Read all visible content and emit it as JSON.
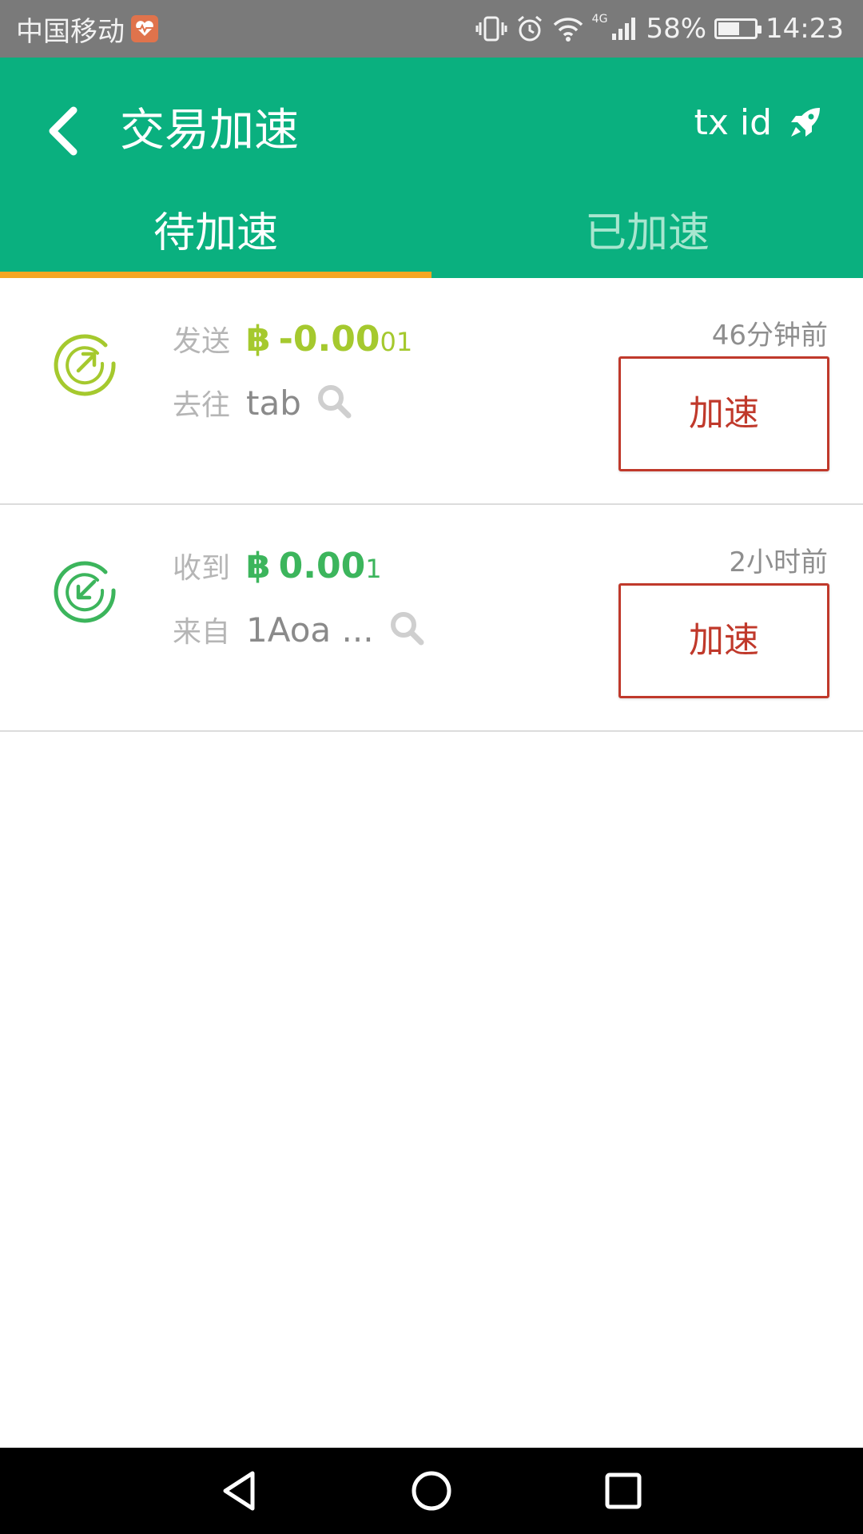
{
  "status_bar": {
    "carrier": "中国移动",
    "network": "4G",
    "battery": "58%",
    "battery_level": 0.58,
    "time": "14:23",
    "icons": [
      "health-app-icon",
      "vibrate-icon",
      "alarm-icon",
      "wifi-icon",
      "signal-icon",
      "battery-icon"
    ]
  },
  "header": {
    "title": "交易加速",
    "txid_label": "tx id",
    "icons": [
      "back-arrow-icon",
      "rocket-icon"
    ]
  },
  "tabs": [
    {
      "label": "待加速",
      "active": true
    },
    {
      "label": "已加速",
      "active": false
    }
  ],
  "transactions": [
    {
      "direction_label": "发送",
      "btc_symbol": "฿",
      "amount_main": "-0.00",
      "amount_small": "01",
      "address_label": "去往",
      "address": "tab",
      "time": "46分钟前",
      "button_label": "加速",
      "color": "#a5c92e",
      "icon": "send-arrow-icon"
    },
    {
      "direction_label": "收到",
      "btc_symbol": "฿",
      "amount_main": "0.00",
      "amount_small": "1",
      "address_label": "来自",
      "address": "1Aoa ...",
      "time": "2小时前",
      "button_label": "加速",
      "color": "#3cb55c",
      "icon": "receive-arrow-icon"
    }
  ],
  "colors": {
    "primary": "#0ab07f",
    "tab_indicator": "#f5a623",
    "accelerate": "#c0392b"
  },
  "nav_bar": {
    "icons": [
      "nav-back-icon",
      "nav-home-icon",
      "nav-recent-icon"
    ]
  }
}
